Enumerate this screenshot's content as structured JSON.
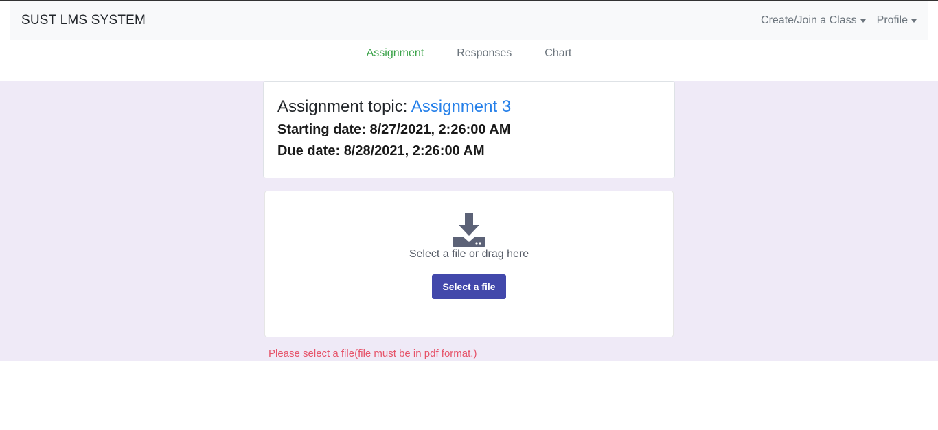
{
  "navbar": {
    "brand": "SUST LMS SYSTEM",
    "create_join": "Create/Join a Class",
    "profile": "Profile"
  },
  "tabs": [
    {
      "label": "Assignment",
      "active": true
    },
    {
      "label": "Responses",
      "active": false
    },
    {
      "label": "Chart",
      "active": false
    }
  ],
  "assignment": {
    "topic_label": "Assignment topic:",
    "topic_value": "Assignment 3",
    "start_label": "Starting date:",
    "start_value": "8/27/2021, 2:26:00 AM",
    "due_label": "Due date:",
    "due_value": "8/28/2021, 2:26:00 AM"
  },
  "upload": {
    "icon": "download-icon",
    "prompt": "Select a file or drag here",
    "button_label": "Select a file"
  },
  "error": "Please select a file(file must be in pdf format.)",
  "colors": {
    "active_tab": "#3ca34a",
    "topic_link": "#2680e9",
    "button": "#4248ab",
    "error": "#e6546a",
    "background": "#efeaf7"
  }
}
